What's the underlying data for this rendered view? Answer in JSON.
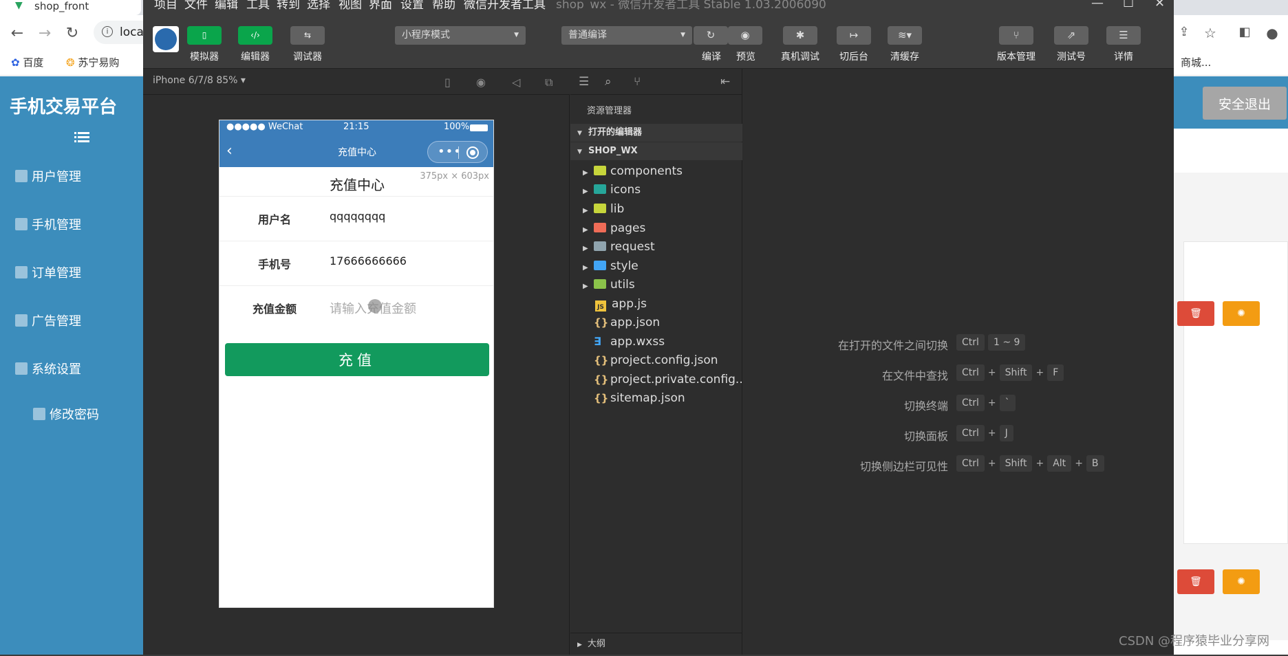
{
  "browser": {
    "tab_title": "shop_front",
    "address_text": "loca",
    "bookmarks": [
      "百度",
      "苏宁易购",
      "商城..."
    ]
  },
  "admin": {
    "title": "手机交易平台",
    "menu": [
      {
        "label": "用户管理",
        "icon": "user-icon"
      },
      {
        "label": "手机管理",
        "icon": "briefcase-icon"
      },
      {
        "label": "订单管理",
        "icon": "clipboard-icon"
      },
      {
        "label": "广告管理",
        "icon": "image-icon"
      },
      {
        "label": "系统设置",
        "icon": "table-icon"
      }
    ],
    "submenu_item": "修改密码",
    "logout_label": "安全退出"
  },
  "devtools": {
    "menubar": [
      "项目",
      "文件",
      "编辑",
      "工具",
      "转到",
      "选择",
      "视图",
      "界面",
      "设置",
      "帮助",
      "微信开发者工具"
    ],
    "title": "shop_wx - 微信开发者工具 Stable 1.03.2006090",
    "toolbar": {
      "simulator": "模拟器",
      "editor": "编辑器",
      "debugger": "调试器",
      "mode_select": "小程序模式",
      "compile_select": "普通编译",
      "compile": "编译",
      "preview": "预览",
      "real_debug": "真机调试",
      "background": "切后台",
      "clear_cache": "清缓存",
      "version": "版本管理",
      "test_account": "测试号",
      "details": "详情"
    },
    "simulator": {
      "device": "iPhone 6/7/8 85% ▾",
      "status_left": "●●●●● WeChat",
      "status_time": "21:15",
      "status_battery": "100%",
      "nav_title": "充值中心",
      "dimension": "375px × 603px",
      "page_heading": "充值中心",
      "fields": [
        {
          "label": "用户名",
          "value": "qqqqqqqq",
          "placeholder": ""
        },
        {
          "label": "手机号",
          "value": "17666666666",
          "placeholder": ""
        },
        {
          "label": "充值金额",
          "value": "",
          "placeholder": "请输入充值金额"
        }
      ],
      "submit_label": "充值"
    },
    "explorer": {
      "title": "资源管理器",
      "open_editors": "打开的编辑器",
      "project": "SHOP_WX",
      "folders": [
        {
          "name": "components",
          "color": "#c6d53b"
        },
        {
          "name": "icons",
          "color": "#26a69a"
        },
        {
          "name": "lib",
          "color": "#c6d53b"
        },
        {
          "name": "pages",
          "color": "#ef6c57"
        },
        {
          "name": "request",
          "color": "#90a4ae"
        },
        {
          "name": "style",
          "color": "#42a5f5"
        },
        {
          "name": "utils",
          "color": "#8bc34a"
        }
      ],
      "files": [
        {
          "name": "app.js",
          "type": "js"
        },
        {
          "name": "app.json",
          "type": "json"
        },
        {
          "name": "app.wxss",
          "type": "wxss"
        },
        {
          "name": "project.config.json",
          "type": "json"
        },
        {
          "name": "project.private.config...",
          "type": "json"
        },
        {
          "name": "sitemap.json",
          "type": "json"
        }
      ],
      "outline": "大纲"
    },
    "shortcuts": [
      {
        "desc": "在打开的文件之间切换",
        "keys": [
          "Ctrl",
          "1 ~ 9"
        ],
        "joined": false
      },
      {
        "desc": "在文件中查找",
        "keys": [
          "Ctrl",
          "Shift",
          "F"
        ],
        "joined": true
      },
      {
        "desc": "切换终端",
        "keys": [
          "Ctrl",
          "`"
        ],
        "joined": true
      },
      {
        "desc": "切换面板",
        "keys": [
          "Ctrl",
          "J"
        ],
        "joined": true
      },
      {
        "desc": "切换侧边栏可见性",
        "keys": [
          "Ctrl",
          "Shift",
          "Alt",
          "B"
        ],
        "joined": true
      }
    ]
  },
  "watermark": "CSDN @程序猿毕业分享网"
}
